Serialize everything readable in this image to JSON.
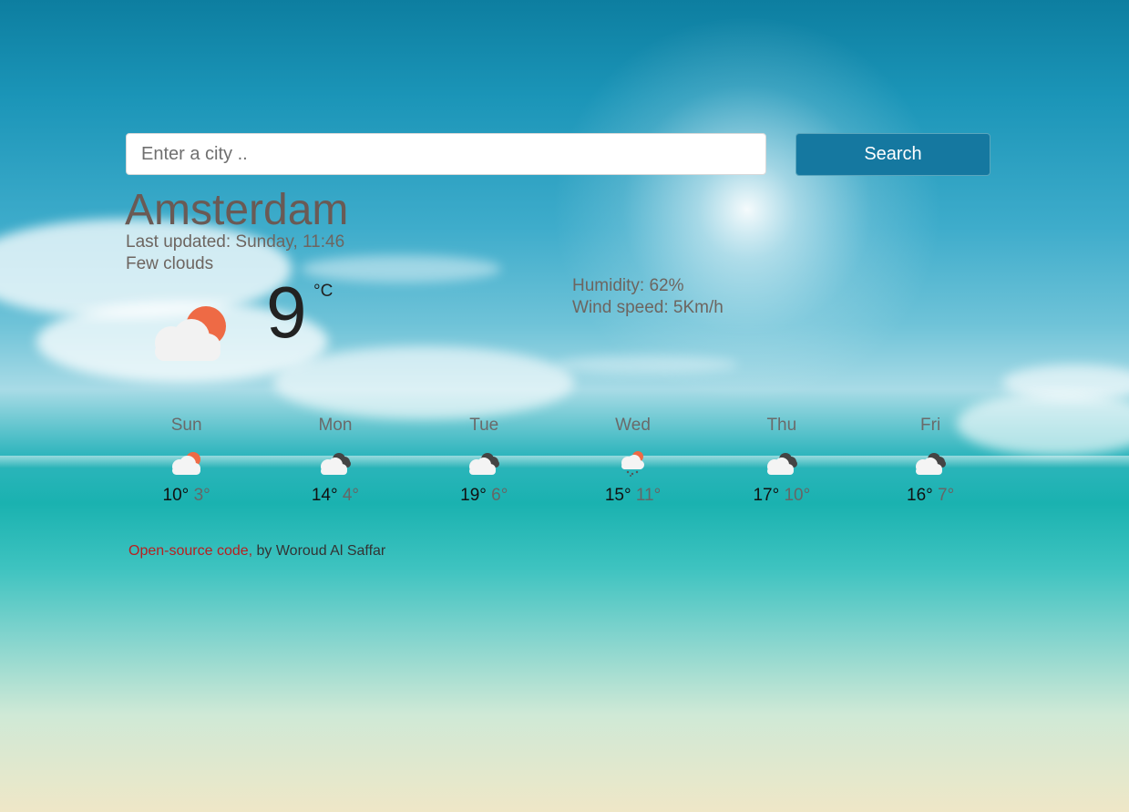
{
  "search": {
    "placeholder": "Enter a city ..",
    "button_label": "Search"
  },
  "current": {
    "city": "Amsterdam",
    "last_updated": "Last updated: Sunday, 11:46",
    "description": "Few clouds",
    "temperature": "9",
    "unit": "°C",
    "humidity": "Humidity: 62%",
    "wind": "Wind speed: 5Km/h",
    "icon": "partly-cloudy-day-icon"
  },
  "forecast": [
    {
      "day": "Sun",
      "max": "10°",
      "min": "3°",
      "icon": "partly-cloudy-day-icon"
    },
    {
      "day": "Mon",
      "max": "14°",
      "min": "4°",
      "icon": "cloudy-icon"
    },
    {
      "day": "Tue",
      "max": "19°",
      "min": "6°",
      "icon": "cloudy-icon"
    },
    {
      "day": "Wed",
      "max": "15°",
      "min": "11°",
      "icon": "snow-icon"
    },
    {
      "day": "Thu",
      "max": "17°",
      "min": "10°",
      "icon": "cloudy-icon"
    },
    {
      "day": "Fri",
      "max": "16°",
      "min": "7°",
      "icon": "cloudy-icon"
    }
  ],
  "footer": {
    "link_text": "Open-source code,",
    "byline": " by Woroud Al Saffar"
  },
  "colors": {
    "button": "#1578a0",
    "link": "#b81f1f",
    "sun": "#ee6a45"
  }
}
